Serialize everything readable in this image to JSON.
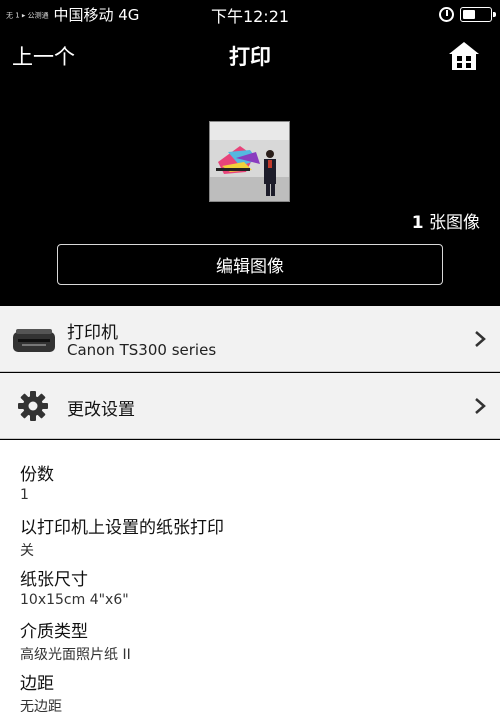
{
  "status_bar": {
    "carrier_prefix": "无 1 ▸ 公测通",
    "carrier": "中国移动",
    "network": "4G",
    "time": "下午12:21"
  },
  "nav": {
    "back_label": "上一个",
    "title": "打印"
  },
  "preview": {
    "count_number": "1",
    "count_label": "张图像",
    "edit_button": "编辑图像"
  },
  "printer": {
    "title": "打印机",
    "model": "Canon TS300 series"
  },
  "settings": {
    "title": "更改设置"
  },
  "details": [
    {
      "label": "份数",
      "value": "1"
    },
    {
      "label": "以打印机上设置的纸张打印",
      "value": "关"
    },
    {
      "label": "纸张尺寸",
      "value": "10x15cm 4\"x6\""
    },
    {
      "label": "介质类型",
      "value": "高级光面照片纸 II"
    },
    {
      "label": "边距",
      "value": "无边距"
    }
  ],
  "icons": {
    "home": "home-icon",
    "printer": "printer-icon",
    "settings": "gear-icon",
    "chevron": "chevron-right-icon",
    "alarm": "alarm-icon",
    "battery": "battery-icon"
  },
  "colors": {
    "header_background": "#000000",
    "row_background": "#f2f2f2",
    "details_background": "#ffffff"
  }
}
